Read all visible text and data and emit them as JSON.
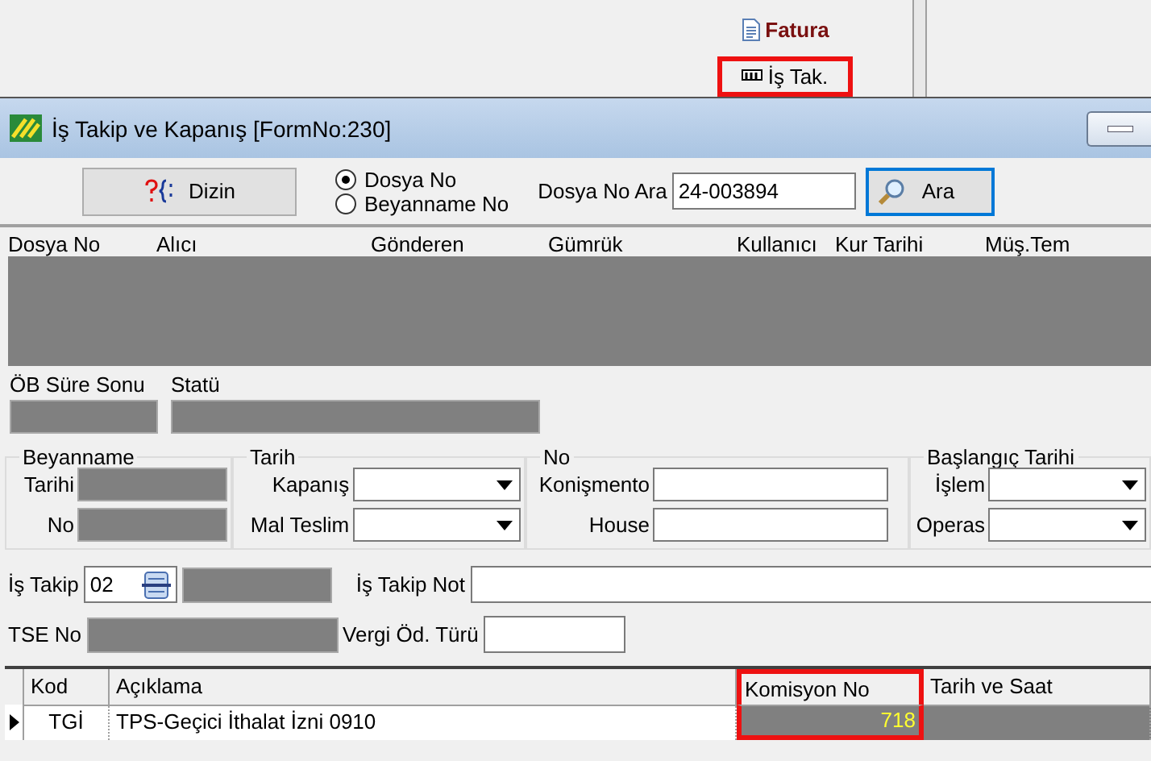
{
  "top_menu": [
    {
      "label": "Fatura",
      "kind": "document",
      "highlighted": false
    },
    {
      "label": "İş Tak.",
      "kind": "tracker",
      "highlighted": true
    }
  ],
  "window": {
    "title": "İş Takip ve Kapanış [FormNo:230]"
  },
  "toolbar": {
    "index_button": "Dizin",
    "search_by": [
      {
        "label": "Dosya No",
        "selected": true
      },
      {
        "label": "Beyanname No",
        "selected": false
      }
    ],
    "search_label": "Dosya No Ara",
    "search_value": "24-003894",
    "search_button": "Ara"
  },
  "file_grid": {
    "columns": [
      "Dosya No",
      "Alıcı",
      "Gönderen",
      "Gümrük",
      "Kullanıcı",
      "Kur Tarihi",
      "Müş.Tem"
    ]
  },
  "status_fields": [
    "ÖB Süre Sonu",
    "Statü"
  ],
  "groups": [
    {
      "title": "Beyanname",
      "fields": [
        {
          "label": "Tarihi",
          "kind": "readonly"
        },
        {
          "label": "No",
          "kind": "readonly"
        }
      ]
    },
    {
      "title": "Tarih",
      "fields": [
        {
          "label": "Kapanış",
          "kind": "dropdown"
        },
        {
          "label": "Mal Teslim",
          "kind": "dropdown"
        }
      ]
    },
    {
      "title": "No",
      "fields": [
        {
          "label": "Konişmento",
          "kind": "text"
        },
        {
          "label": "House",
          "kind": "text"
        }
      ]
    },
    {
      "title": "Başlangıç Tarihi",
      "fields": [
        {
          "label": "İşlem",
          "kind": "dropdown"
        },
        {
          "label": "Operas",
          "kind": "dropdown"
        }
      ]
    }
  ],
  "tracking": {
    "label": "İş Takip",
    "code": "02",
    "note_label": "İş Takip Not"
  },
  "tse": {
    "label": "TSE No",
    "tax_label": "Vergi Öd. Türü"
  },
  "table": {
    "columns": [
      {
        "label": "Kod",
        "highlighted": false
      },
      {
        "label": "Açıklama",
        "highlighted": false
      },
      {
        "label": "Komisyon No",
        "highlighted": true
      },
      {
        "label": "Tarih ve Saat",
        "highlighted": false
      }
    ],
    "rows": [
      {
        "current": true,
        "cells": [
          "TGİ",
          "TPS-Geçici İthalat İzni 0910",
          "718",
          ""
        ]
      }
    ]
  }
}
